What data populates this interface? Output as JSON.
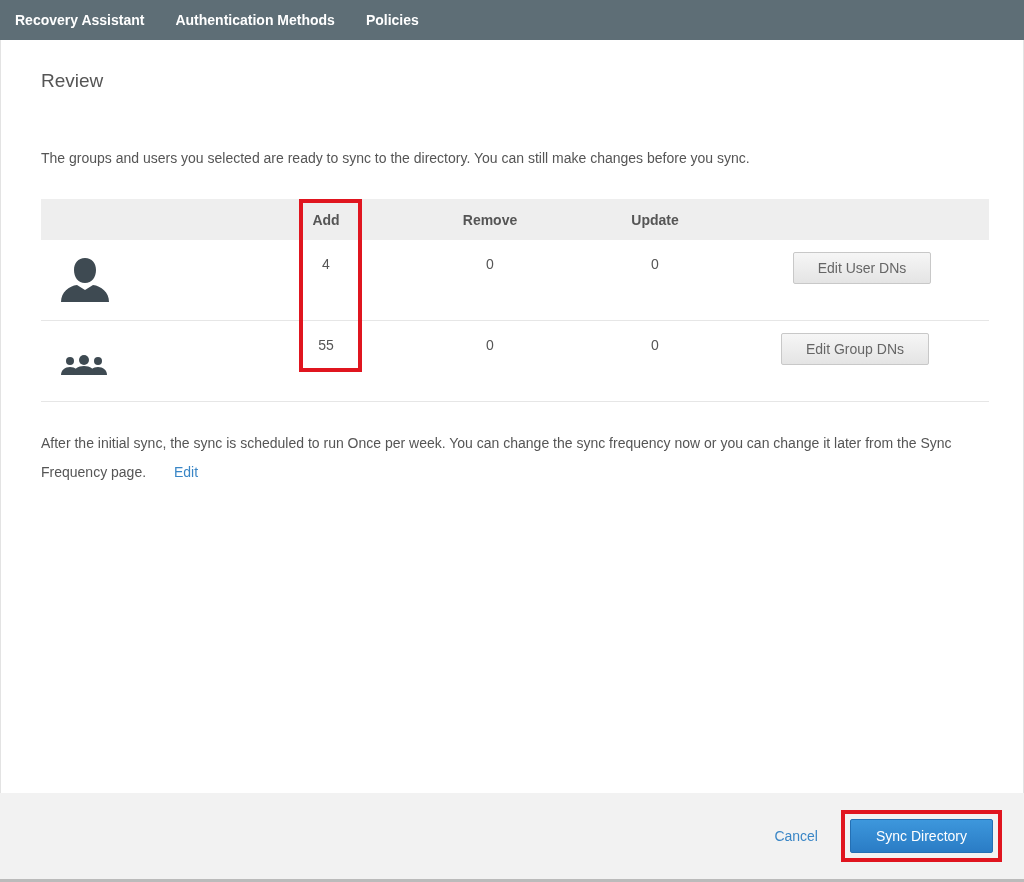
{
  "nav": {
    "items": [
      "Recovery Assistant",
      "Authentication Methods",
      "Policies"
    ]
  },
  "page": {
    "title": "Review",
    "intro": "The groups and users you selected are ready to sync to the directory. You can still make changes before you sync."
  },
  "table": {
    "columns": [
      {
        "label": "Add",
        "highlighted": true
      },
      {
        "label": "Remove",
        "highlighted": false
      },
      {
        "label": "Update",
        "highlighted": false
      }
    ],
    "rows": [
      {
        "kind": "user",
        "values": [
          "4",
          "0",
          "0"
        ],
        "action": "Edit User DNs"
      },
      {
        "kind": "group",
        "values": [
          "55",
          "0",
          "0"
        ],
        "action": "Edit Group DNs"
      }
    ]
  },
  "schedule": {
    "text": "After the initial sync, the sync is scheduled to run Once per week. You can change the sync frequency now or you can change it later from the Sync Frequency page.",
    "link": "Edit"
  },
  "footer": {
    "cancel": "Cancel",
    "primary": {
      "label": "Sync Directory",
      "highlighted": true
    }
  }
}
